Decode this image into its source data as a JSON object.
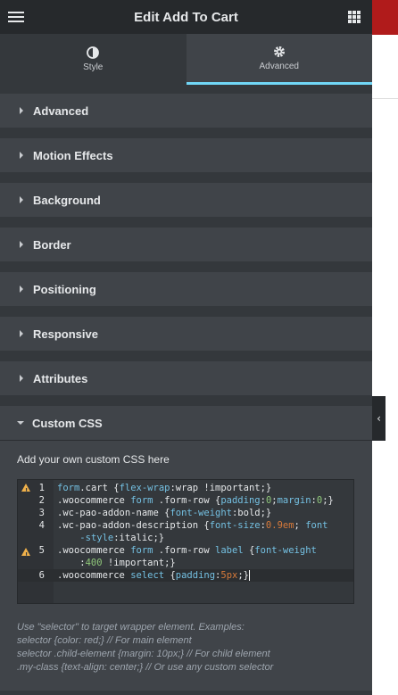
{
  "header": {
    "title": "Edit Add To Cart",
    "menu_icon": "hamburger-icon",
    "grid_icon": "apps-grid-icon"
  },
  "tabs": [
    {
      "label": "Style",
      "icon": "contrast-icon",
      "active": false
    },
    {
      "label": "Advanced",
      "icon": "gear-icon",
      "active": true
    }
  ],
  "sections": [
    {
      "label": "Advanced"
    },
    {
      "label": "Motion Effects"
    },
    {
      "label": "Background"
    },
    {
      "label": "Border"
    },
    {
      "label": "Positioning"
    },
    {
      "label": "Responsive"
    },
    {
      "label": "Attributes"
    }
  ],
  "custom_css": {
    "label": "Custom CSS",
    "prompt": "Add your own custom CSS here",
    "lines": [
      {
        "num": "1",
        "warn": true
      },
      {
        "num": "2",
        "warn": false
      },
      {
        "num": "3",
        "warn": false
      },
      {
        "num": "4",
        "warn": false
      },
      {
        "num": "5",
        "warn": true
      },
      {
        "num": "6",
        "warn": false
      }
    ],
    "hint": [
      "Use \"selector\" to target wrapper element. Examples:",
      "selector {color: red;} // For main element",
      "selector .child-element {margin: 10px;} // For child element",
      ".my-class {text-align: center;} // Or use any custom selector"
    ]
  },
  "colors": {
    "accent": "#71d7f7",
    "panel": "#404449",
    "warning": "#f0b14a",
    "brand_red": "#b01b1b"
  }
}
